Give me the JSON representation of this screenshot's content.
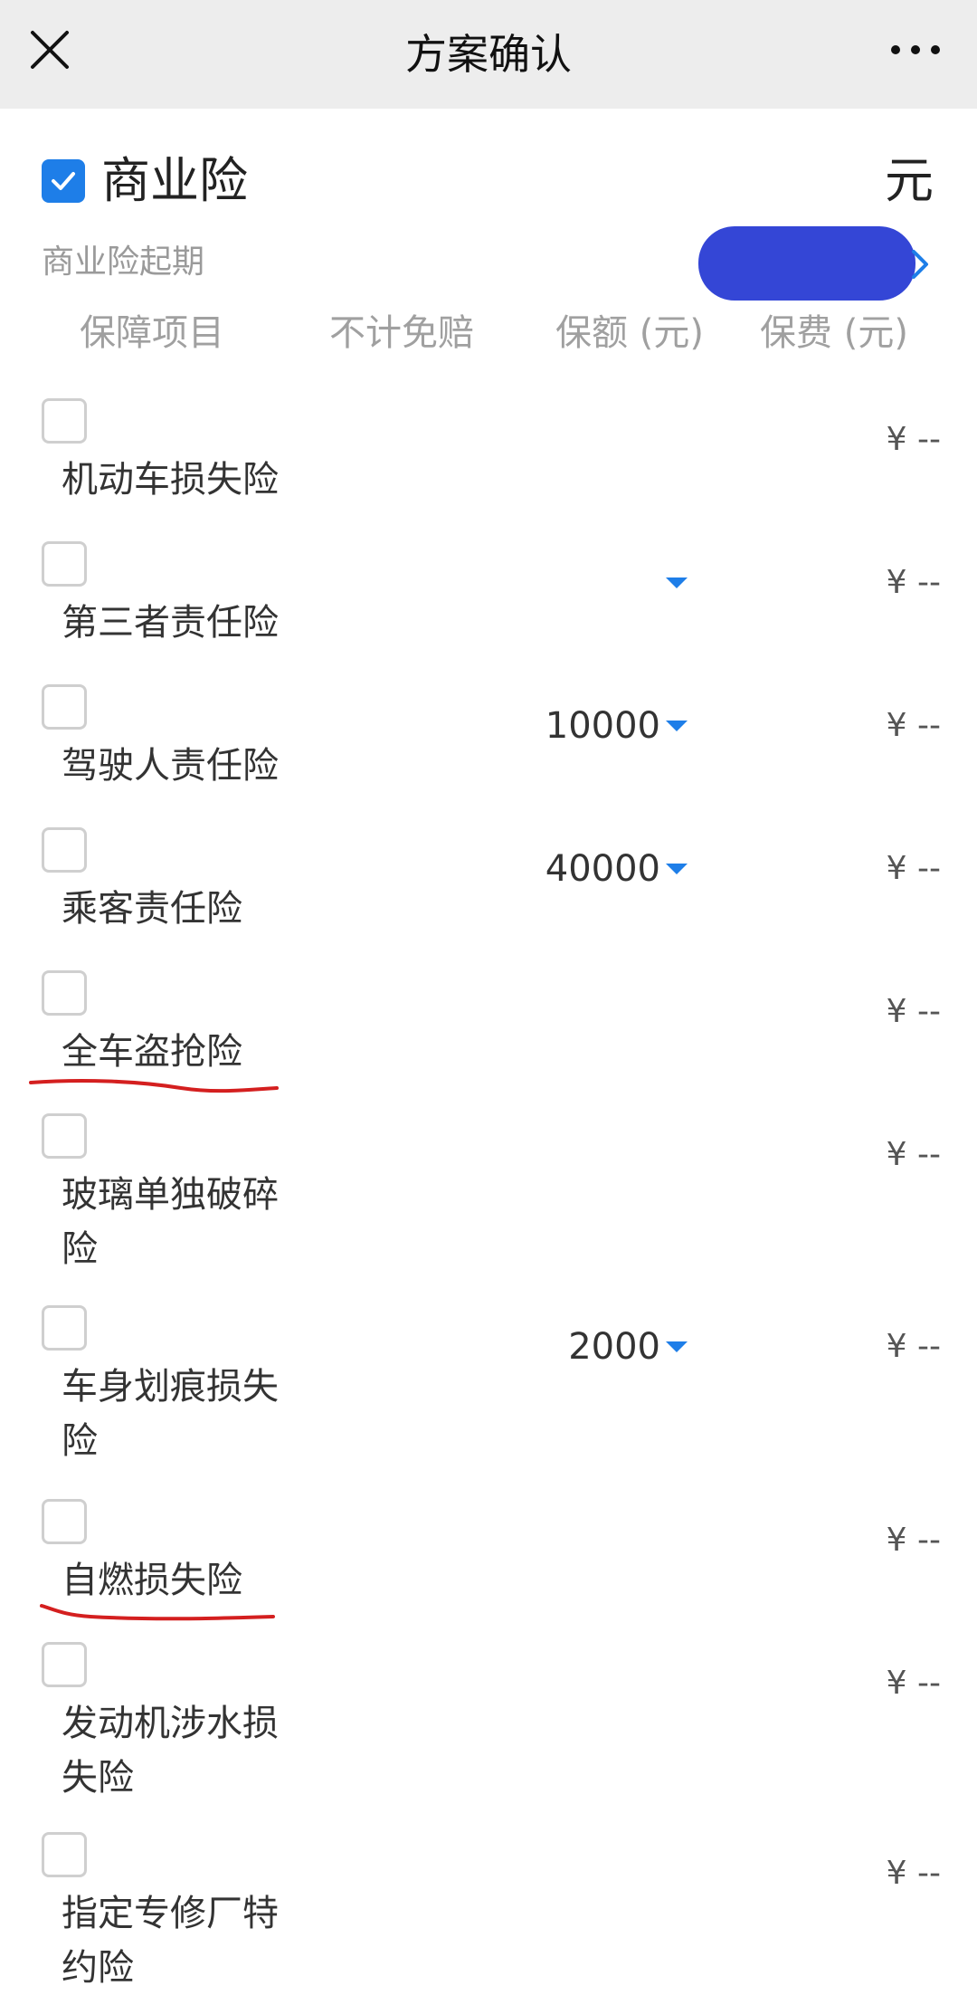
{
  "nav": {
    "title": "方案确认",
    "close_icon": "close-icon",
    "more_icon": "more-icon"
  },
  "section": {
    "title": "商业险",
    "unit": "元",
    "checked": true,
    "start_label": "商业险起期"
  },
  "columns": {
    "item": "保障项目",
    "deductible": "不计免赔",
    "coverage": "保额 (元)",
    "premium": "保费 (元)"
  },
  "rows": [
    {
      "name": "机动车损失险",
      "amount": "",
      "fee": "¥ --"
    },
    {
      "name": "第三者责任险",
      "amount": "",
      "fee": "¥ --"
    },
    {
      "name": "驾驶人责任险",
      "amount": "10000",
      "fee": "¥ --"
    },
    {
      "name": "乘客责任险",
      "amount": "40000",
      "fee": "¥ --"
    },
    {
      "name": "全车盗抢险",
      "amount": "",
      "fee": "¥ --"
    },
    {
      "name": "玻璃单独破碎险",
      "amount": "",
      "fee": "¥ --"
    },
    {
      "name": "车身划痕损失险",
      "amount": "2000",
      "fee": "¥ --"
    },
    {
      "name": "自燃损失险",
      "amount": "",
      "fee": "¥ --"
    },
    {
      "name": "发动机涉水损失险",
      "amount": "",
      "fee": "¥ --"
    },
    {
      "name": "指定专修厂特约险",
      "amount": "",
      "fee": "¥ --"
    }
  ],
  "colors": {
    "accent": "#1e7ee8",
    "annotation": "#d41f1f",
    "scribble": "#3446d6"
  }
}
